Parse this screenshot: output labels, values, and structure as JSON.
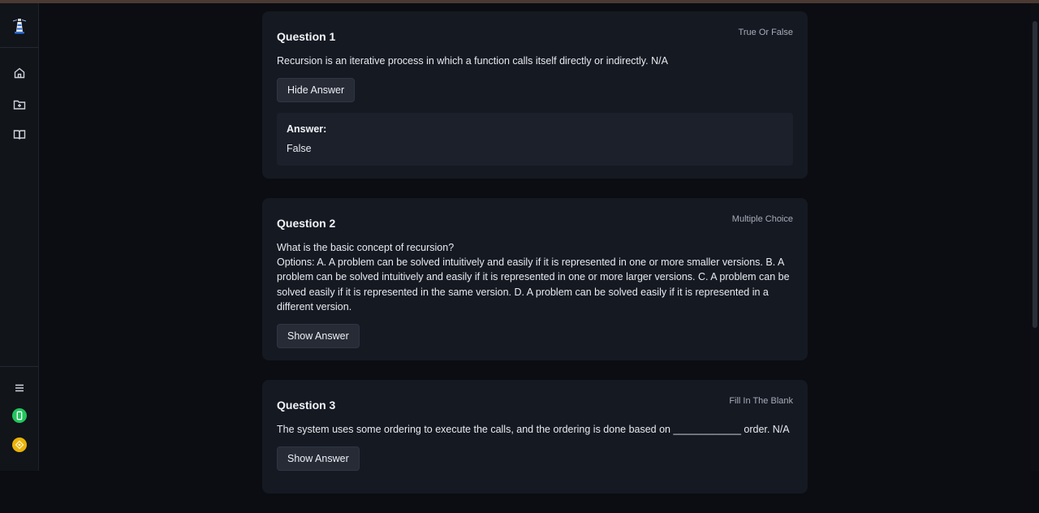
{
  "sidebar": {
    "logo": "lighthouse-logo",
    "items": [
      {
        "icon": "home-icon"
      },
      {
        "icon": "folder-plus-icon"
      },
      {
        "icon": "book-open-icon"
      }
    ],
    "bottom": [
      {
        "icon": "menu-icon"
      },
      {
        "icon": "green-app-icon",
        "color": "#22c55e"
      },
      {
        "icon": "yellow-app-icon",
        "color": "#eab308"
      }
    ]
  },
  "questions": [
    {
      "title": "Question 1",
      "type": "True Or False",
      "text": "Recursion is an iterative process in which a function calls itself directly or indirectly. N/A",
      "button": "Hide Answer",
      "answer_label": "Answer:",
      "answer_value": "False"
    },
    {
      "title": "Question 2",
      "type": "Multiple Choice",
      "text_line1": "What is the basic concept of recursion?",
      "text_line2": "Options: A. A problem can be solved intuitively and easily if it is represented in one or more smaller versions. B. A problem can be solved intuitively and easily if it is represented in one or more larger versions. C. A problem can be solved easily if it is represented in the same version. D. A problem can be solved easily if it is represented in a different version.",
      "button": "Show Answer"
    },
    {
      "title": "Question 3",
      "type": "Fill In The Blank",
      "text": "The system uses some ordering to execute the calls, and the ordering is done based on ____________ order. N/A",
      "button": "Show Answer"
    }
  ]
}
